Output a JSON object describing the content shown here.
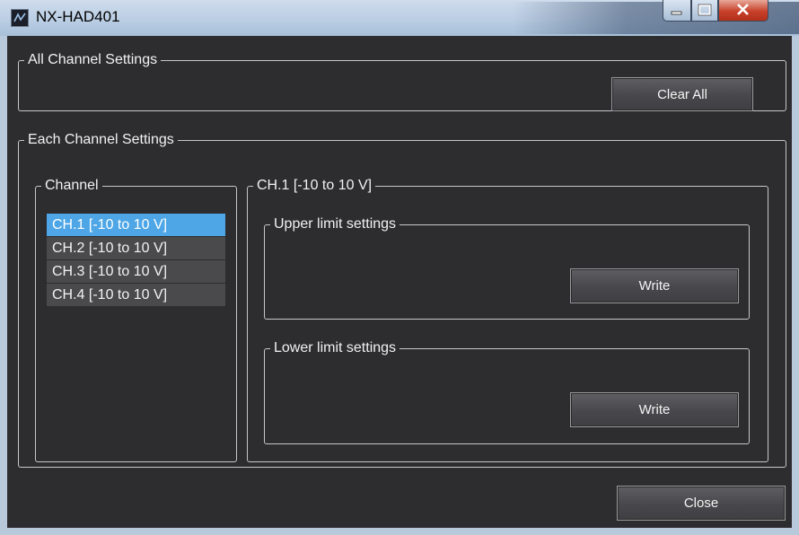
{
  "window": {
    "title": "NX-HAD401",
    "controls": {
      "minimize": "minimize",
      "maximize": "maximize",
      "close": "close"
    }
  },
  "all_channel": {
    "legend": "All Channel Settings",
    "clear_all_label": "Clear All"
  },
  "each_channel": {
    "legend": "Each Channel Settings",
    "channel_list": {
      "legend": "Channel",
      "items": [
        {
          "label": "CH.1  [-10 to 10 V]",
          "selected": true
        },
        {
          "label": "CH.2  [-10 to 10 V]",
          "selected": false
        },
        {
          "label": "CH.3  [-10 to 10 V]",
          "selected": false
        },
        {
          "label": "CH.4  [-10 to 10 V]",
          "selected": false
        }
      ]
    },
    "detail": {
      "legend": "CH.1  [-10 to 10 V]",
      "upper": {
        "legend": "Upper limit settings",
        "write_label": "Write"
      },
      "lower": {
        "legend": "Lower limit settings",
        "write_label": "Write"
      }
    }
  },
  "footer": {
    "close_label": "Close"
  },
  "colors": {
    "panel_bg": "#2d2d30",
    "selection": "#4ea6e6",
    "border": "#c7c7c7"
  }
}
